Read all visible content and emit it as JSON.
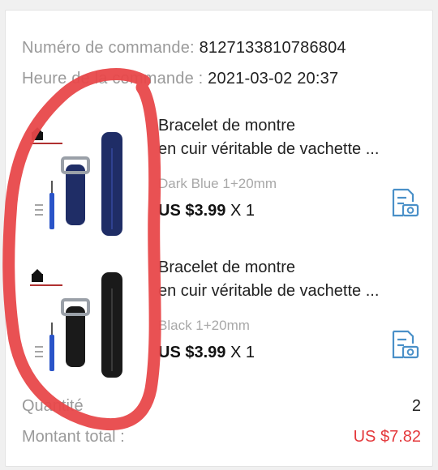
{
  "order": {
    "number_label": "Numéro de commande:",
    "number_value": "8127133810786804",
    "time_label": "Heure de la commande :",
    "time_value": "2021-03-02 20:37"
  },
  "products": [
    {
      "title_line1": "Bracelet de montre",
      "title_line2": "en cuir véritable de vachette ...",
      "variant": "Dark Blue 1+20mm",
      "price": "US $3.99",
      "qty": "X 1",
      "strap_color": "#1f2d66"
    },
    {
      "title_line1": "Bracelet de montre",
      "title_line2": "en cuir véritable de vachette ...",
      "variant": "Black 1+20mm",
      "price": "US $3.99",
      "qty": "X 1",
      "strap_color": "#1a1a1a"
    }
  ],
  "summary": {
    "quantity_label": "Quantité",
    "quantity_value": "2",
    "total_label": "Montant total :",
    "total_value": "US $7.82"
  },
  "colors": {
    "accent_blue": "#4a90c8",
    "price_red": "#e4393c",
    "annotation_red": "#e8484a"
  },
  "icons": [
    "snapshot-icon",
    "genuine-leather-logo",
    "screwdriver-icon"
  ]
}
